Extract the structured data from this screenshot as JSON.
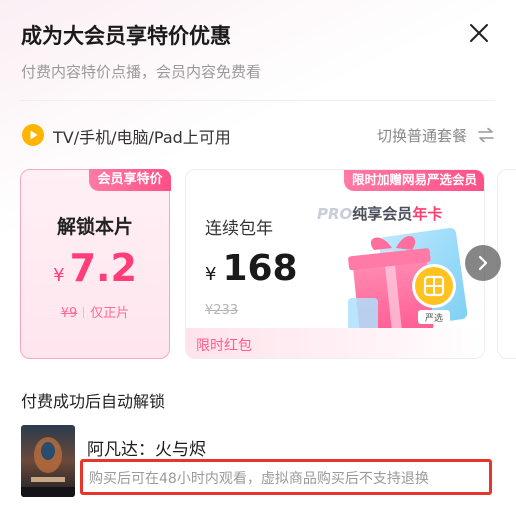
{
  "header": {
    "title": "成为大会员享特价优惠",
    "subtitle": "付费内容特价点播，会员内容免费看"
  },
  "platform": {
    "text": "TV/手机/电脑/Pad上可用",
    "switch_label": "切换普通套餐"
  },
  "plans": [
    {
      "badge": "会员享特价",
      "name": "解锁本片",
      "currency": "¥",
      "price": "7.2",
      "original_price": "¥9",
      "note": "仅正片",
      "selected": true
    },
    {
      "badge": "限时加赠网易严选会员",
      "name": "连续包年",
      "currency": "¥",
      "price": "168",
      "original_price": "¥233",
      "promo_pro": "PRO",
      "promo_mid": "纯享会员",
      "promo_end": "年卡",
      "gift_label": "严选",
      "bottom_tag": "限时红包",
      "selected": false
    }
  ],
  "content": {
    "unlock_note": "付费成功后自动解锁",
    "movie_title": "阿凡达：火与烬",
    "disclaimer": "购买后可在48小时内观看，虚拟商品购买后不支持退换"
  },
  "colors": {
    "accent_pink": "#ff3d78",
    "highlight_red": "#e8352c",
    "icon_yellow": "#ffb400"
  },
  "icons": {
    "close": "close-icon",
    "platform": "play-icon",
    "swap": "swap-arrows-icon",
    "next": "chevron-right-icon"
  }
}
